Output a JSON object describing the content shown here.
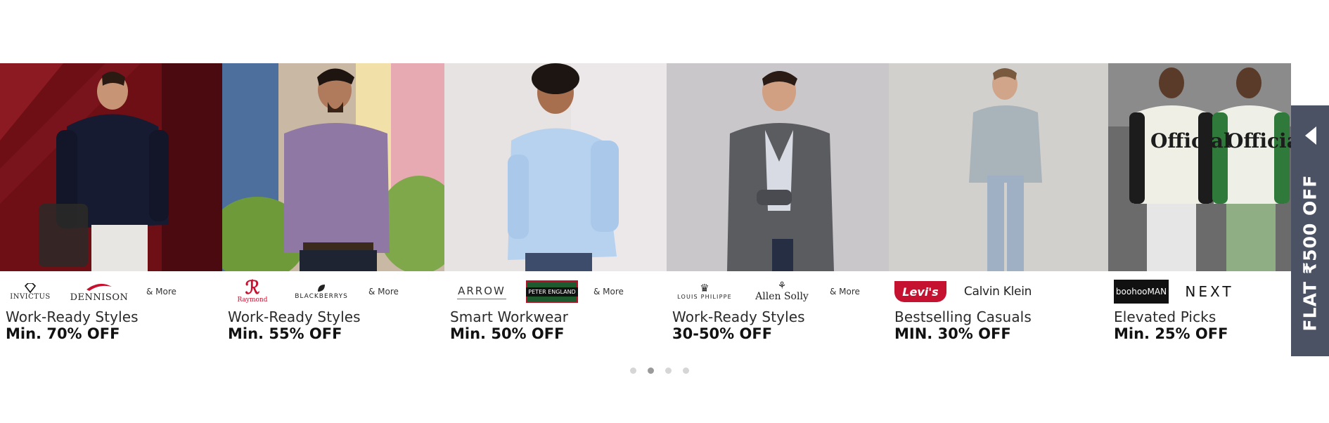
{
  "carousel": {
    "cards": [
      {
        "title": "Work-Ready Styles",
        "offer": "Min. 70% OFF",
        "logos": [
          "INVICTUS",
          "DENNISON"
        ],
        "more": "& More"
      },
      {
        "title": "Work-Ready Styles",
        "offer": "Min. 55% OFF",
        "logos": [
          "Raymond",
          "BLACKBERRYS"
        ],
        "more": "& More"
      },
      {
        "title": "Smart Workwear",
        "offer": "Min. 50% OFF",
        "logos": [
          "ARROW",
          "PETER ENGLAND"
        ],
        "more": "& More"
      },
      {
        "title": "Work-Ready Styles",
        "offer": "30-50% OFF",
        "logos": [
          "LOUIS PHILIPPE",
          "Allen Solly"
        ],
        "more": "& More"
      },
      {
        "title": "Bestselling Casuals",
        "offer": "MIN. 30% OFF",
        "logos": [
          "Levi's",
          "Calvin Klein"
        ],
        "more": ""
      },
      {
        "title": "Elevated Picks",
        "offer": "Min. 25% OFF",
        "logos": [
          "boohooMAN",
          "NEXT"
        ],
        "more": ""
      }
    ],
    "dots": {
      "count": 4,
      "active_index": 1
    }
  },
  "side_tab": {
    "label": "FLAT ₹500 OFF"
  },
  "colors": {
    "side_tab_bg": "#4b5263",
    "dot_inactive": "#d6d6d6",
    "dot_active": "#9a9a9a"
  }
}
